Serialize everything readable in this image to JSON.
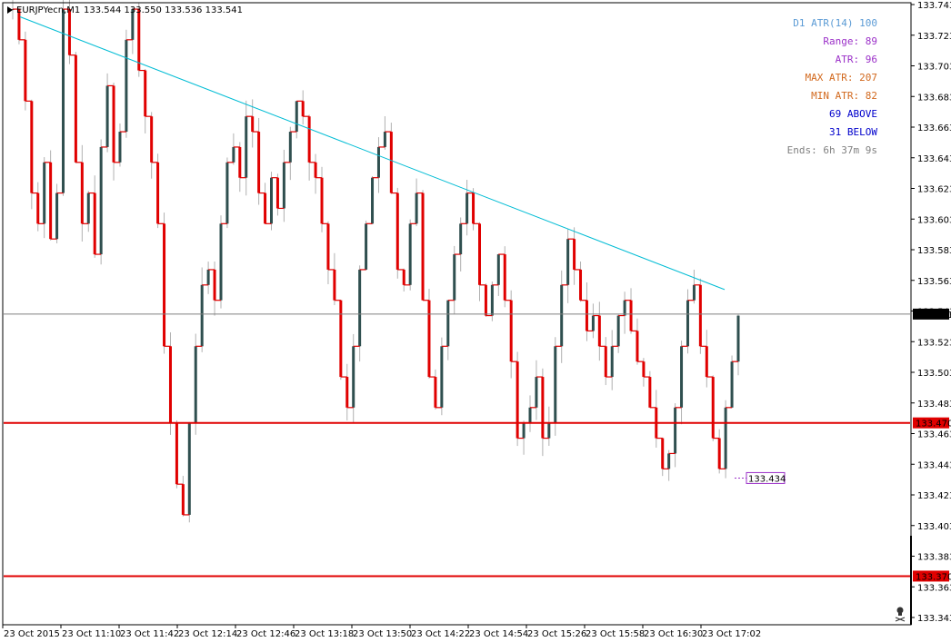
{
  "header": {
    "symbol_text": "EURJPYecn,M1",
    "ohlc_text": "133.544 133.550 133.536 133.541"
  },
  "info_panel": [
    {
      "text": "D1 ATR(14) 100",
      "color": "#5b9bd5"
    },
    {
      "text": "Range: 89",
      "color": "#9b30c8"
    },
    {
      "text": "ATR: 96",
      "color": "#9b30c8"
    },
    {
      "text": "MAX ATR: 207",
      "color": "#d2691e"
    },
    {
      "text": "MIN ATR: 82",
      "color": "#d2691e"
    },
    {
      "text": "69 ABOVE",
      "color": "#0000cc"
    },
    {
      "text": "31 BELOW",
      "color": "#0000cc"
    },
    {
      "text": "Ends: 6h 37m 9s",
      "color": "#808080"
    }
  ],
  "price_axis": {
    "ticks": [
      "133.743",
      "133.723",
      "133.703",
      "133.683",
      "133.663",
      "133.643",
      "133.623",
      "133.603",
      "133.583",
      "133.563",
      "133.543",
      "133.523",
      "133.503",
      "133.483",
      "133.463",
      "133.443",
      "133.423",
      "133.403",
      "133.383",
      "133.363",
      "133.343"
    ]
  },
  "time_axis": {
    "ticks": [
      "23 Oct 2015",
      "23 Oct 11:10",
      "23 Oct 11:42",
      "23 Oct 12:14",
      "23 Oct 12:46",
      "23 Oct 13:18",
      "23 Oct 13:50",
      "23 Oct 14:22",
      "23 Oct 14:54",
      "23 Oct 15:26",
      "23 Oct 15:58",
      "23 Oct 16:30",
      "23 Oct 17:02"
    ]
  },
  "levels": {
    "bid": {
      "label": "133.541",
      "price": 133.541
    },
    "resistance": {
      "label": "133.470",
      "price": 133.47
    },
    "support": {
      "label": "133.370",
      "price": 133.37
    },
    "marker": {
      "label": "133.434",
      "price": 133.434
    }
  },
  "colors": {
    "bull": "#2f4f4f",
    "bear": "#e00000",
    "trendline": "#00bcd4",
    "level": "#e00000",
    "bidline": "#808080",
    "marker": "#9b30c8"
  },
  "chart_data": {
    "type": "candlestick",
    "symbol": "EURJPYecn",
    "timeframe": "M1",
    "y_range": [
      133.343,
      133.743
    ],
    "close_path": [
      133.74,
      133.72,
      133.68,
      133.62,
      133.6,
      133.64,
      133.59,
      133.62,
      133.74,
      133.71,
      133.64,
      133.6,
      133.62,
      133.58,
      133.65,
      133.69,
      133.64,
      133.66,
      133.72,
      133.74,
      133.7,
      133.67,
      133.64,
      133.6,
      133.52,
      133.47,
      133.43,
      133.41,
      133.47,
      133.52,
      133.56,
      133.57,
      133.55,
      133.6,
      133.64,
      133.65,
      133.63,
      133.67,
      133.66,
      133.62,
      133.6,
      133.63,
      133.61,
      133.64,
      133.66,
      133.68,
      133.67,
      133.64,
      133.63,
      133.6,
      133.57,
      133.55,
      133.5,
      133.48,
      133.52,
      133.57,
      133.6,
      133.63,
      133.65,
      133.66,
      133.62,
      133.57,
      133.56,
      133.6,
      133.62,
      133.55,
      133.5,
      133.48,
      133.52,
      133.55,
      133.58,
      133.6,
      133.62,
      133.6,
      133.56,
      133.54,
      133.56,
      133.58,
      133.55,
      133.51,
      133.46,
      133.47,
      133.48,
      133.5,
      133.46,
      133.47,
      133.52,
      133.56,
      133.59,
      133.57,
      133.55,
      133.53,
      133.54,
      133.52,
      133.5,
      133.52,
      133.54,
      133.55,
      133.53,
      133.51,
      133.5,
      133.48,
      133.46,
      133.44,
      133.45,
      133.48,
      133.52,
      133.55,
      133.56,
      133.52,
      133.5,
      133.46,
      133.44,
      133.48,
      133.51,
      133.54
    ],
    "trendline": [
      {
        "time": "23 Oct 2015",
        "price": 133.735
      },
      {
        "time": "23 Oct 17:02",
        "price": 133.557
      }
    ]
  }
}
